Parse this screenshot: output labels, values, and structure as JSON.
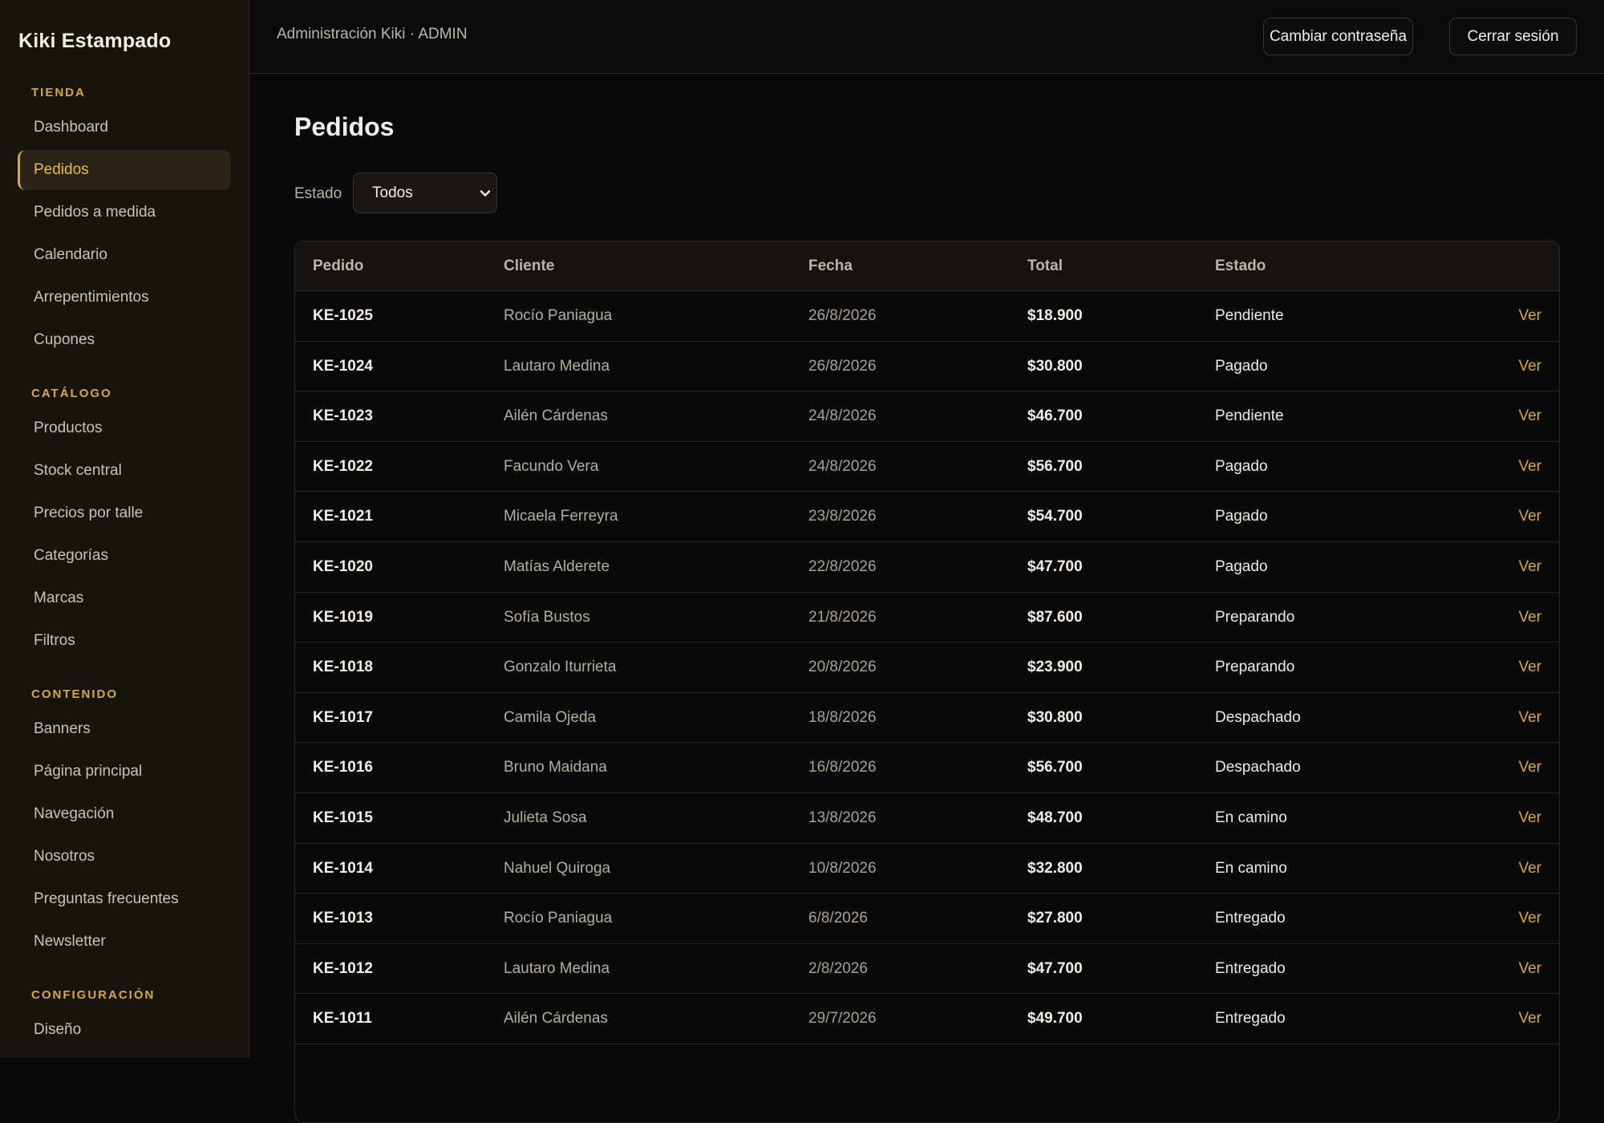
{
  "app": {
    "brand": "Kiki Estampado"
  },
  "sidebar": {
    "sections": [
      {
        "heading": "TIENDA",
        "items": [
          {
            "label": "Dashboard",
            "active": false
          },
          {
            "label": "Pedidos",
            "active": true
          },
          {
            "label": "Pedidos a medida",
            "active": false
          },
          {
            "label": "Calendario",
            "active": false
          },
          {
            "label": "Arrepentimientos",
            "active": false
          },
          {
            "label": "Cupones",
            "active": false
          }
        ]
      },
      {
        "heading": "CATÁLOGO",
        "items": [
          {
            "label": "Productos",
            "active": false
          },
          {
            "label": "Stock central",
            "active": false
          },
          {
            "label": "Precios por talle",
            "active": false
          },
          {
            "label": "Categorías",
            "active": false
          },
          {
            "label": "Marcas",
            "active": false
          },
          {
            "label": "Filtros",
            "active": false
          }
        ]
      },
      {
        "heading": "CONTENIDO",
        "items": [
          {
            "label": "Banners",
            "active": false
          },
          {
            "label": "Página principal",
            "active": false
          },
          {
            "label": "Navegación",
            "active": false
          },
          {
            "label": "Nosotros",
            "active": false
          },
          {
            "label": "Preguntas frecuentes",
            "active": false
          },
          {
            "label": "Newsletter",
            "active": false
          }
        ]
      },
      {
        "heading": "CONFIGURACIÓN",
        "items": [
          {
            "label": "Diseño",
            "active": false
          }
        ]
      }
    ]
  },
  "topbar": {
    "title": "Administración Kiki · ADMIN",
    "change_password_label": "Cambiar contraseña",
    "logout_label": "Cerrar sesión"
  },
  "main": {
    "title": "Pedidos",
    "filter": {
      "label": "Estado",
      "selected": "Todos",
      "icon": "chevron-down-icon"
    },
    "table": {
      "columns": [
        "Pedido",
        "Cliente",
        "Fecha",
        "Total",
        "Estado"
      ],
      "action_label": "Ver",
      "rows": [
        {
          "id": "KE-1025",
          "client": "Rocío Paniagua",
          "date": "26/8/2026",
          "total": "$18.900",
          "status": "Pendiente"
        },
        {
          "id": "KE-1024",
          "client": "Lautaro Medina",
          "date": "26/8/2026",
          "total": "$30.800",
          "status": "Pagado"
        },
        {
          "id": "KE-1023",
          "client": "Ailén Cárdenas",
          "date": "24/8/2026",
          "total": "$46.700",
          "status": "Pendiente"
        },
        {
          "id": "KE-1022",
          "client": "Facundo Vera",
          "date": "24/8/2026",
          "total": "$56.700",
          "status": "Pagado"
        },
        {
          "id": "KE-1021",
          "client": "Micaela Ferreyra",
          "date": "23/8/2026",
          "total": "$54.700",
          "status": "Pagado"
        },
        {
          "id": "KE-1020",
          "client": "Matías Alderete",
          "date": "22/8/2026",
          "total": "$47.700",
          "status": "Pagado"
        },
        {
          "id": "KE-1019",
          "client": "Sofía Bustos",
          "date": "21/8/2026",
          "total": "$87.600",
          "status": "Preparando"
        },
        {
          "id": "KE-1018",
          "client": "Gonzalo Iturrieta",
          "date": "20/8/2026",
          "total": "$23.900",
          "status": "Preparando"
        },
        {
          "id": "KE-1017",
          "client": "Camila Ojeda",
          "date": "18/8/2026",
          "total": "$30.800",
          "status": "Despachado"
        },
        {
          "id": "KE-1016",
          "client": "Bruno Maidana",
          "date": "16/8/2026",
          "total": "$56.700",
          "status": "Despachado"
        },
        {
          "id": "KE-1015",
          "client": "Julieta Sosa",
          "date": "13/8/2026",
          "total": "$48.700",
          "status": "En camino"
        },
        {
          "id": "KE-1014",
          "client": "Nahuel Quiroga",
          "date": "10/8/2026",
          "total": "$32.800",
          "status": "En camino"
        },
        {
          "id": "KE-1013",
          "client": "Rocío Paniagua",
          "date": "6/8/2026",
          "total": "$27.800",
          "status": "Entregado"
        },
        {
          "id": "KE-1012",
          "client": "Lautaro Medina",
          "date": "2/8/2026",
          "total": "$47.700",
          "status": "Entregado"
        },
        {
          "id": "KE-1011",
          "client": "Ailén Cárdenas",
          "date": "29/7/2026",
          "total": "$49.700",
          "status": "Entregado"
        }
      ]
    }
  },
  "colors": {
    "accent": "#d6a842",
    "background": "#0a0a0a",
    "sidebar": "#17140f"
  }
}
